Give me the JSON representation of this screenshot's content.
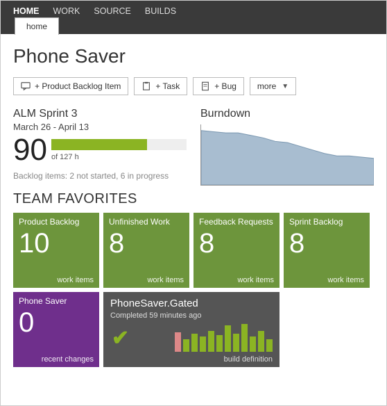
{
  "nav": {
    "items": [
      "HOME",
      "WORK",
      "SOURCE",
      "BUILDS"
    ],
    "active_index": 0,
    "sub_tab": "home"
  },
  "page": {
    "title": "Phone Saver"
  },
  "toolbar": {
    "backlog_label": "+ Product Backlog Item",
    "task_label": "+ Task",
    "bug_label": "+ Bug",
    "more_label": "more"
  },
  "sprint": {
    "title": "ALM Sprint 3",
    "dates": "March 26 - April 13",
    "completed": 90,
    "of_label": "of 127 h",
    "backlog_status": "Backlog items: 2 not started, 6 in progress",
    "progress_pct": 71
  },
  "burndown": {
    "title": "Burndown"
  },
  "chart_data": {
    "type": "area",
    "title": "Burndown",
    "x": [
      0,
      1,
      2,
      3,
      4,
      5,
      6,
      7,
      8,
      9,
      10,
      11,
      12,
      13,
      14
    ],
    "values": [
      90,
      88,
      86,
      86,
      82,
      78,
      72,
      70,
      64,
      58,
      52,
      48,
      48,
      46,
      44
    ],
    "ylim": [
      0,
      100
    ],
    "color": "#a8bdd0"
  },
  "favorites": {
    "heading": "TEAM FAVORITES",
    "tiles": [
      {
        "title": "Product Backlog",
        "value": "10",
        "footer": "work items",
        "color": "green"
      },
      {
        "title": "Unfinished Work",
        "value": "8",
        "footer": "work items",
        "color": "green"
      },
      {
        "title": "Feedback Requests",
        "value": "8",
        "footer": "work items",
        "color": "green"
      },
      {
        "title": "Sprint Backlog",
        "value": "8",
        "footer": "work items",
        "color": "green"
      },
      {
        "title": "Phone Saver",
        "value": "0",
        "footer": "recent changes",
        "color": "purple"
      }
    ],
    "build_tile": {
      "title": "PhoneSaver.Gated",
      "subtitle": "Completed 59 minutes ago",
      "footer": "build definition",
      "bars": [
        {
          "h": 28,
          "status": "fail"
        },
        {
          "h": 18,
          "status": "ok"
        },
        {
          "h": 26,
          "status": "ok"
        },
        {
          "h": 22,
          "status": "ok"
        },
        {
          "h": 30,
          "status": "ok"
        },
        {
          "h": 24,
          "status": "ok"
        },
        {
          "h": 38,
          "status": "ok"
        },
        {
          "h": 26,
          "status": "ok"
        },
        {
          "h": 40,
          "status": "ok"
        },
        {
          "h": 22,
          "status": "ok"
        },
        {
          "h": 30,
          "status": "ok"
        },
        {
          "h": 18,
          "status": "ok"
        }
      ]
    }
  }
}
